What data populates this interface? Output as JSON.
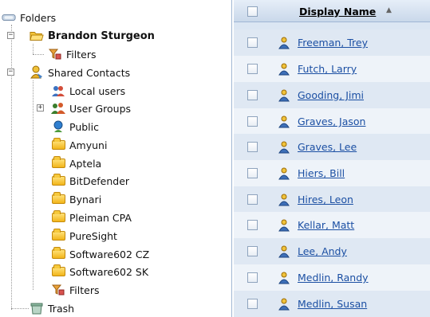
{
  "tree": {
    "root_label": "Folders",
    "items": [
      {
        "label": "Brandon Sturgeon",
        "icon": "open-folder-icon"
      },
      {
        "label": "Filters",
        "icon": "filter-icon"
      },
      {
        "label": "Shared Contacts",
        "icon": "shared-contacts-icon"
      },
      {
        "label": "Local users",
        "icon": "local-users-icon"
      },
      {
        "label": "User Groups",
        "icon": "user-groups-icon"
      },
      {
        "label": "Public",
        "icon": "public-icon"
      },
      {
        "label": "Amyuni",
        "icon": "folder-icon"
      },
      {
        "label": "Aptela",
        "icon": "folder-icon"
      },
      {
        "label": "BitDefender",
        "icon": "folder-icon"
      },
      {
        "label": "Bynari",
        "icon": "folder-icon"
      },
      {
        "label": "Pleiman CPA",
        "icon": "folder-icon"
      },
      {
        "label": "PureSight",
        "icon": "folder-icon"
      },
      {
        "label": "Software602 CZ",
        "icon": "folder-icon"
      },
      {
        "label": "Software602 SK",
        "icon": "folder-icon"
      },
      {
        "label": "Filters",
        "icon": "filter-icon"
      },
      {
        "label": "Trash",
        "icon": "trash-icon"
      }
    ]
  },
  "grid": {
    "column_header": "Display Name",
    "sort_indicator": "▲",
    "rows": [
      "Freeman, Trey",
      "Futch, Larry",
      "Gooding, Jimi",
      "Graves, Jason",
      "Graves, Lee",
      "Hiers, Bill",
      "Hires, Leon",
      "Kellar, Matt",
      "Lee, Andy",
      "Medlin, Randy",
      "Medlin, Susan"
    ]
  },
  "colors": {
    "link": "#1b4fa3",
    "grid_row_light": "#eef3f9",
    "grid_row_dark": "#dfe8f3",
    "header_bg": "#c9d8ea"
  }
}
